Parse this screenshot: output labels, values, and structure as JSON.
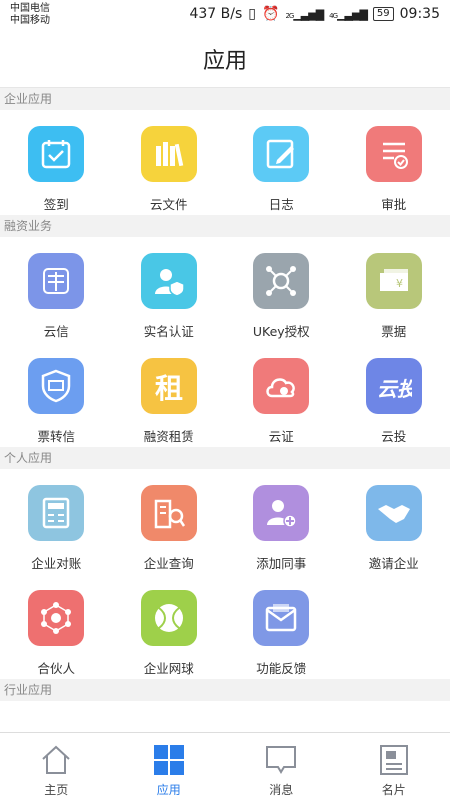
{
  "status": {
    "carrier1": "中国电信",
    "carrier2": "中国移动",
    "speed": "437 B/s",
    "signal1": "2G",
    "signal2": "4G",
    "battery": "59",
    "time": "09:35"
  },
  "title": "应用",
  "sections": [
    {
      "header": "企业应用",
      "items": [
        {
          "label": "签到",
          "color": "#3dbef2",
          "icon": "calendar-check-icon"
        },
        {
          "label": "云文件",
          "color": "#f6d33c",
          "icon": "books-icon"
        },
        {
          "label": "日志",
          "color": "#5ccaf5",
          "icon": "edit-note-icon"
        },
        {
          "label": "审批",
          "color": "#f07a7a",
          "icon": "document-check-icon"
        }
      ]
    },
    {
      "header": "融资业务",
      "items": [
        {
          "label": "云信",
          "color": "#7c95e8",
          "icon": "cloud-letter-icon"
        },
        {
          "label": "实名认证",
          "color": "#49c7e6",
          "icon": "user-shield-icon"
        },
        {
          "label": "UKey授权",
          "color": "#9aa5ad",
          "icon": "ukey-network-icon"
        },
        {
          "label": "票据",
          "color": "#b8c77a",
          "icon": "bill-icon"
        },
        {
          "label": "票转信",
          "color": "#6c9ef0",
          "icon": "bill-shield-icon"
        },
        {
          "label": "融资租赁",
          "color": "#f6c342",
          "icon": "lease-icon"
        },
        {
          "label": "云证",
          "color": "#f07a7a",
          "icon": "cloud-cert-icon"
        },
        {
          "label": "云投",
          "color": "#6e86e6",
          "icon": "cloud-invest-icon"
        }
      ]
    },
    {
      "header": "个人应用",
      "items": [
        {
          "label": "企业对账",
          "color": "#8ec5e0",
          "icon": "calculator-icon"
        },
        {
          "label": "企业查询",
          "color": "#f0896a",
          "icon": "building-search-icon"
        },
        {
          "label": "添加同事",
          "color": "#b08fde",
          "icon": "add-user-icon"
        },
        {
          "label": "邀请企业",
          "color": "#7eb8ea",
          "icon": "handshake-icon"
        },
        {
          "label": "合伙人",
          "color": "#ee7070",
          "icon": "network-icon"
        },
        {
          "label": "企业网球",
          "color": "#9ed04a",
          "icon": "tennis-ball-icon"
        },
        {
          "label": "功能反馈",
          "color": "#7f98e6",
          "icon": "mail-feedback-icon"
        }
      ]
    },
    {
      "header": "行业应用",
      "items": []
    }
  ],
  "nav": {
    "home": "主页",
    "apps": "应用",
    "messages": "消息",
    "card": "名片"
  }
}
